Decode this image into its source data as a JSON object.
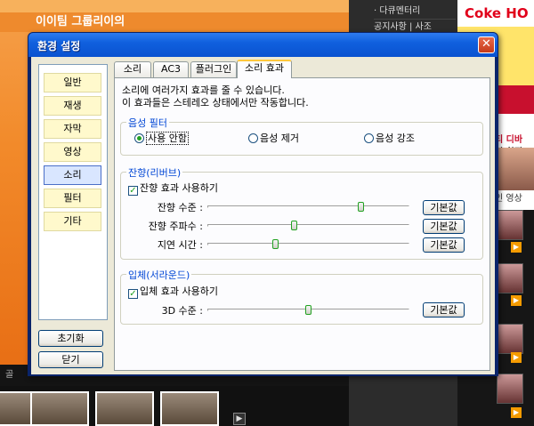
{
  "background": {
    "left_banner": "이이팀 그룹리이의",
    "mid_list": [
      "다큐멘터리",
      "공지사항 | 사조",
      "",
      "",
      ""
    ],
    "coke": "Coke HO",
    "right_text1": "티 디바",
    "right_text2": "인 회징",
    "right_title": "인 영상",
    "strip": "골"
  },
  "dialog": {
    "title": "환경 설정",
    "close_label": "✕",
    "categories": [
      {
        "label": "일반"
      },
      {
        "label": "재생"
      },
      {
        "label": "자막"
      },
      {
        "label": "영상"
      },
      {
        "label": "소리"
      },
      {
        "label": "필터"
      },
      {
        "label": "기타"
      }
    ],
    "selected_category": "소리",
    "reset_label": "초기화",
    "close_button_label": "닫기",
    "tabs": [
      {
        "label": "소리"
      },
      {
        "label": "AC3"
      },
      {
        "label": "플러그인"
      },
      {
        "label": "소리 효과"
      }
    ],
    "active_tab": "소리 효과",
    "description": [
      "소리에 여러가지 효과를 줄 수 있습니다.",
      "이 효과들은 스테레오 상태에서만 작동합니다."
    ],
    "voice_filter": {
      "label": "음성 필터",
      "options": [
        {
          "label": "사용 안함",
          "selected": true
        },
        {
          "label": "음성 제거",
          "selected": false
        },
        {
          "label": "음성 강조",
          "selected": false
        }
      ]
    },
    "reverb": {
      "label": "잔향(리버브)",
      "enable_label": "잔향 효과 사용하기",
      "enabled": true,
      "sliders": [
        {
          "label": "잔향 수준 :",
          "value": 0.76,
          "default_label": "기본값"
        },
        {
          "label": "잔향 주파수 :",
          "value": 0.43,
          "default_label": "기본값"
        },
        {
          "label": "지연 시간 :",
          "value": 0.34,
          "default_label": "기본값"
        }
      ]
    },
    "surround": {
      "label": "입체(서라운드)",
      "enable_label": "입체 효과 사용하기",
      "enabled": true,
      "sliders": [
        {
          "label": "3D 수준 :",
          "value": 0.5,
          "default_label": "기본값"
        }
      ]
    }
  }
}
